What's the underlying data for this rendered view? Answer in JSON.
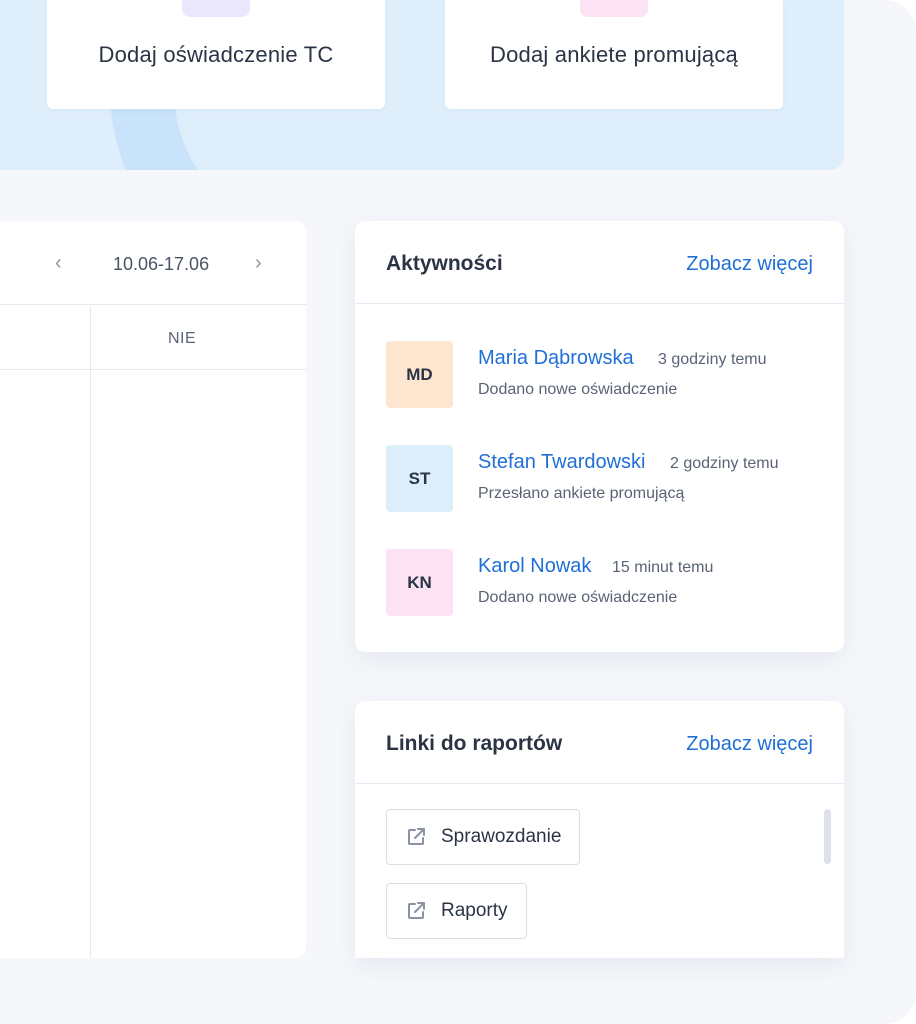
{
  "actions": {
    "card_1": "Dodaj oświadczenie TC",
    "card_2": "Dodaj ankiete promującą"
  },
  "calendar": {
    "prev_icon": "chevron-left-icon",
    "next_icon": "chevron-right-icon",
    "range": "10.06-17.06",
    "day_header": "NIE"
  },
  "activities": {
    "title": "Aktywności",
    "see_more": "Zobacz więcej",
    "items": [
      {
        "initials": "MD",
        "name": "Maria Dąbrowska",
        "time": "3 godziny temu",
        "description": "Dodano nowe oświadczenie",
        "avatar_color": "#fde6d0"
      },
      {
        "initials": "ST",
        "name": "Stefan Twardowski",
        "time": "2 godziny temu",
        "description": "Przesłano ankiete promującą",
        "avatar_color": "#ddeefb"
      },
      {
        "initials": "KN",
        "name": "Karol Nowak",
        "time": "15 minut temu",
        "description": "Dodano nowe oświadczenie",
        "avatar_color": "#fbe3f3"
      }
    ]
  },
  "reports": {
    "title": "Linki do raportów",
    "see_more": "Zobacz więcej",
    "links": [
      {
        "label": "Sprawozdanie",
        "icon": "external-link-icon"
      },
      {
        "label": "Raporty",
        "icon": "external-link-icon"
      }
    ]
  },
  "colors": {
    "accent": "#1f6fd6",
    "banner": "#dfeefb",
    "page_bg": "#f5f7fb"
  }
}
